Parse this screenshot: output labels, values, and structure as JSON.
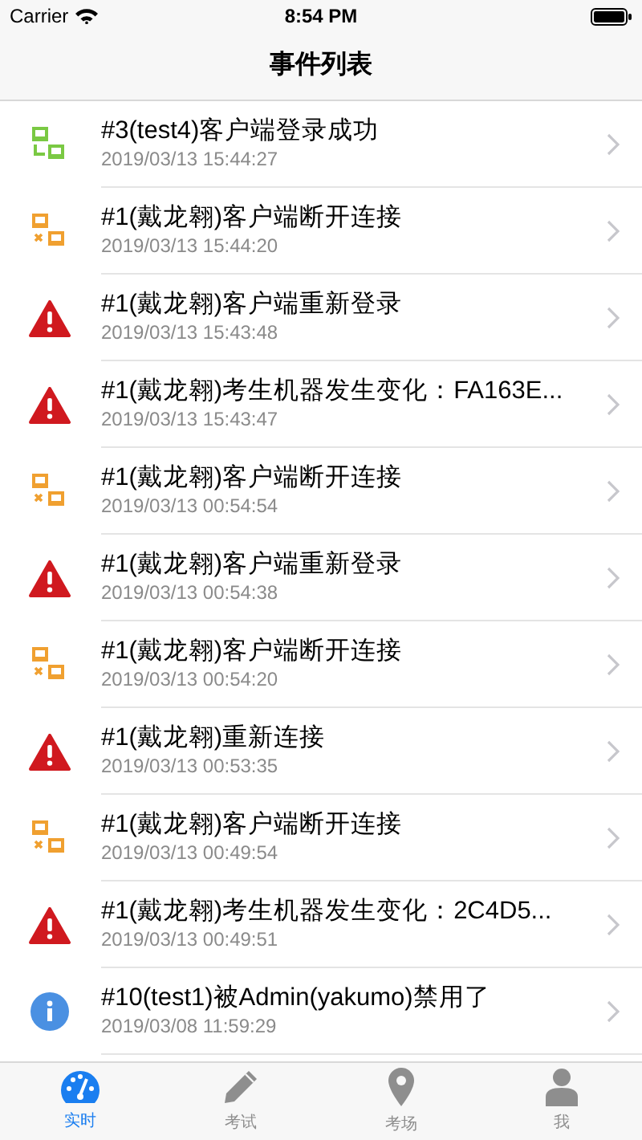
{
  "status_bar": {
    "carrier": "Carrier",
    "time": "8:54 PM"
  },
  "nav": {
    "title": "事件列表"
  },
  "events": [
    {
      "kind": "login",
      "title": "#3(test4)客户端登录成功",
      "time": "2019/03/13 15:44:27"
    },
    {
      "kind": "disconnect",
      "title": "#1(戴龙翱)客户端断开连接",
      "time": "2019/03/13 15:44:20"
    },
    {
      "kind": "warning",
      "title": "#1(戴龙翱)客户端重新登录",
      "time": "2019/03/13 15:43:48"
    },
    {
      "kind": "warning",
      "title": "#1(戴龙翱)考生机器发生变化：FA163E...",
      "time": "2019/03/13 15:43:47"
    },
    {
      "kind": "disconnect",
      "title": "#1(戴龙翱)客户端断开连接",
      "time": "2019/03/13 00:54:54"
    },
    {
      "kind": "warning",
      "title": "#1(戴龙翱)客户端重新登录",
      "time": "2019/03/13 00:54:38"
    },
    {
      "kind": "disconnect",
      "title": "#1(戴龙翱)客户端断开连接",
      "time": "2019/03/13 00:54:20"
    },
    {
      "kind": "warning",
      "title": "#1(戴龙翱)重新连接",
      "time": "2019/03/13 00:53:35"
    },
    {
      "kind": "disconnect",
      "title": "#1(戴龙翱)客户端断开连接",
      "time": "2019/03/13 00:49:54"
    },
    {
      "kind": "warning",
      "title": "#1(戴龙翱)考生机器发生变化：2C4D5...",
      "time": "2019/03/13 00:49:51"
    },
    {
      "kind": "info",
      "title": "#10(test1)被Admin(yakumo)禁用了",
      "time": "2019/03/08 11:59:29"
    }
  ],
  "tabs": [
    {
      "kind": "gauge",
      "label": "实时",
      "selected": true
    },
    {
      "kind": "pencil",
      "label": "考试",
      "selected": false
    },
    {
      "kind": "pin",
      "label": "考场",
      "selected": false
    },
    {
      "kind": "person",
      "label": "我",
      "selected": false
    }
  ]
}
